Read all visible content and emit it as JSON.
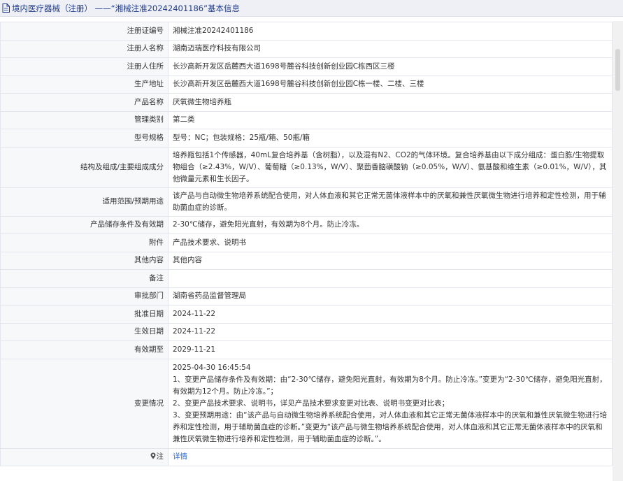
{
  "header": {
    "title": "境内医疗器械（注册） ——“湘械注准20242401186”基本信息"
  },
  "rows": [
    {
      "label": "注册证编号",
      "value": "湘械注准20242401186"
    },
    {
      "label": "注册人名称",
      "value": "湖南迈瑞医疗科技有限公司"
    },
    {
      "label": "注册人住所",
      "value": "长沙高新开发区岳麓西大道1698号麓谷科技创新创业园C栋西区三楼"
    },
    {
      "label": "生产地址",
      "value": "长沙高新开发区岳麓西大道1698号麓谷科技创新创业园C栋一楼、二楼、三楼"
    },
    {
      "label": "产品名称",
      "value": "厌氧微生物培养瓶"
    },
    {
      "label": "管理类别",
      "value": "第二类"
    },
    {
      "label": "型号规格",
      "value": "型号：NC；包装规格：25瓶/箱、50瓶/箱"
    },
    {
      "label": "结构及组成/主要组成成分",
      "value": "培养瓶包括1个传感器，40mL复合培养基（含树脂），以及混有N2、CO2的气体环境。复合培养基由以下成分组成：蛋白胨/生物提取物组合（≥2.43%，W/V）、葡萄糖（≥0.13%，W/V）、聚茴香脑磺酸钠（≥0.05%，W/V）、氨基酸和维生素（≥0.01%，W/V），其他微量元素和生长因子。"
    },
    {
      "label": "适用范围/预期用途",
      "value": "该产品与自动微生物培养系统配合使用，对人体血液和其它正常无菌体液样本中的厌氧和兼性厌氧微生物进行培养和定性检测，用于辅助菌血症的诊断。"
    },
    {
      "label": "产品储存条件及有效期",
      "value": "2-30℃储存，避免阳光直射，有效期为8个月。防止冷冻。"
    },
    {
      "label": "附件",
      "value": "产品技术要求、说明书"
    },
    {
      "label": "其他内容",
      "value": "其他内容"
    },
    {
      "label": "备注",
      "value": ""
    },
    {
      "label": "审批部门",
      "value": "湖南省药品监督管理局"
    },
    {
      "label": "批准日期",
      "value": "2024-11-22"
    },
    {
      "label": "生效日期",
      "value": "2024-11-22"
    },
    {
      "label": "有效期至",
      "value": "2029-11-21"
    }
  ],
  "changes": {
    "label": "变更情况",
    "date": "2025-04-30 16:45:54",
    "item1": "1、变更产品储存条件及有效期：由“2-30℃储存，避免阳光直射，有效期为8个月。防止冷冻。”变更为“2-30℃储存，避免阳光直射，有效期为12个月。防止冷冻。”；",
    "item2": "2、变更产品技术要求、说明书，详见产品技术要求变更对比表、说明书变更对比表；",
    "item3": "3、变更预期用途：由“该产品与自动微生物培养系统配合使用，对人体血液和其它正常无菌体液样本中的厌氧和兼性厌氧微生物进行培养和定性检测，用于辅助菌血症的诊断。”变更为“该产品与微生物培养系统配合使用，对人体血液和其它正常无菌体液样本中的厌氧和兼性厌氧微生物进行培养和定性检测，用于辅助菌血症的诊断。”。"
  },
  "note": {
    "label": "注",
    "link": "详情"
  },
  "colors": {
    "link": "#2d6ed3",
    "header_bg": "#eef0f5",
    "label_bg": "#f7f8fa",
    "border": "#e3e6ec"
  }
}
